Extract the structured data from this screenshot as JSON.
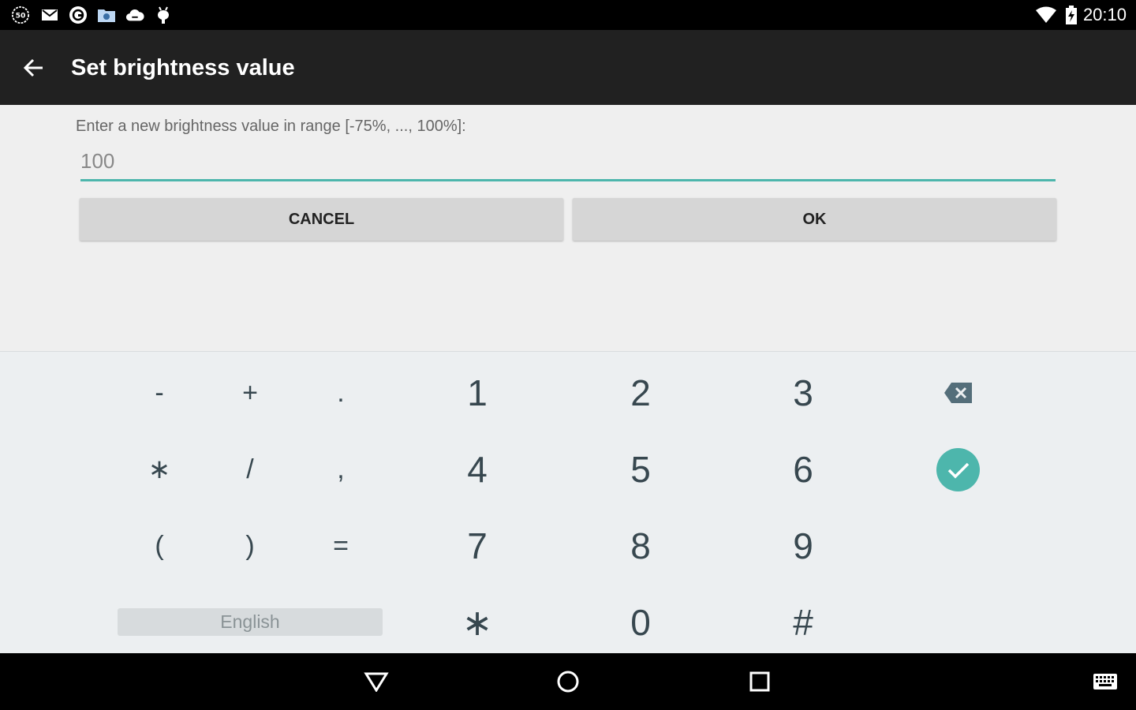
{
  "status_bar": {
    "time": "20:10",
    "left_icons": [
      "badge-50-icon",
      "gmail-icon",
      "sync-icon",
      "folder-settings-icon",
      "cloud-icon",
      "android-debug-icon"
    ],
    "badge_text": "50",
    "right_icons": [
      "wifi-icon",
      "battery-charging-icon"
    ]
  },
  "app_bar": {
    "title": "Set brightness value",
    "back_icon": "arrow-back-icon"
  },
  "dialog": {
    "prompt": "Enter a new brightness value in range [-75%, ..., 100%]:",
    "input_value": "100",
    "cancel_label": "CANCEL",
    "ok_label": "OK",
    "accent_color": "#4db6ac"
  },
  "keyboard": {
    "symbol_keys": [
      [
        "-",
        "+",
        "."
      ],
      [
        "∗",
        "/",
        ","
      ],
      [
        "(",
        ")",
        "="
      ]
    ],
    "number_keys": [
      [
        "1",
        "2",
        "3"
      ],
      [
        "4",
        "5",
        "6"
      ],
      [
        "7",
        "8",
        "9"
      ],
      [
        "∗",
        "0",
        "#"
      ]
    ],
    "language_label": "English",
    "delete_icon": "backspace-icon",
    "enter_icon": "check-icon"
  },
  "nav_bar": {
    "icons": [
      "back-triangle-icon",
      "home-circle-icon",
      "recents-square-icon",
      "keyboard-icon"
    ]
  }
}
